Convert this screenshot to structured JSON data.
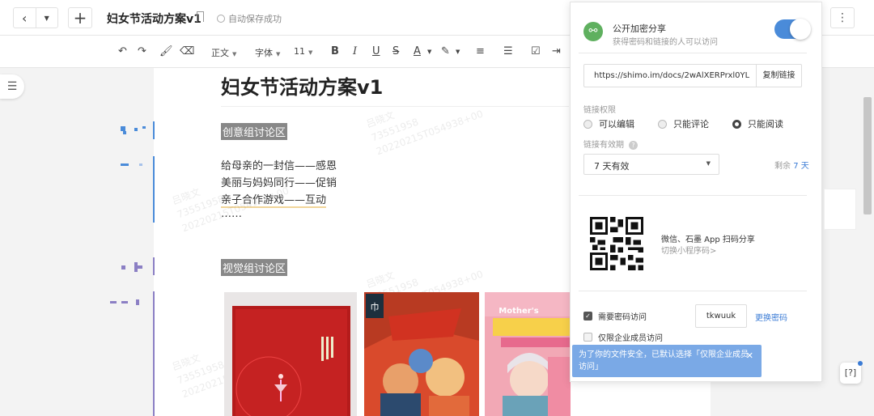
{
  "header": {
    "title": "妇女节活动方案v1",
    "autosave": "自动保存成功",
    "back_icon": "‹",
    "more": "⋮"
  },
  "toolbar": {
    "style": "正文",
    "font": "字体",
    "size": "11",
    "bold": "B",
    "italic": "I",
    "underline": "U",
    "strike": "S",
    "color": "A"
  },
  "doc": {
    "title": "妇女节活动方案v1",
    "sec1": "创意组讨论区",
    "lines": [
      "给母亲的一封信——感恩",
      "美丽与妈妈同行——促销",
      "亲子合作游戏——互动",
      "……"
    ],
    "sec2": "视觉组讨论区",
    "watermark": [
      "吕晓文",
      "73551958",
      "20220215T054938+00"
    ]
  },
  "share": {
    "title": "公开加密分享",
    "subtitle": "获得密码和链接的人可以访问",
    "url": "https://shimo.im/docs/2wAlXERPrxl0YLAl",
    "copy": "复制链接",
    "perm_label": "链接权限",
    "perm_options": [
      "可以编辑",
      "只能评论",
      "只能阅读"
    ],
    "validity_label": "链接有效期",
    "validity_value": "7 天有效",
    "remaining_prefix": "剩余",
    "remaining_value": "7 天",
    "qr_text": "微信、石墨 App 扫码分享",
    "qr_sub": "切换小程序码>",
    "need_pw": "需要密码访问",
    "password": "tkwuuk",
    "change_pw": "更换密码",
    "enterprise_only": "仅限企业成员访问",
    "tip": "为了你的文件安全，已默认选择「仅限企业成员访问」"
  },
  "colors": {
    "accent": "#3a7bd5",
    "toggle": "#4a8bd9",
    "tip": "#7aa9e6",
    "link_icon": "#5fb05f"
  }
}
